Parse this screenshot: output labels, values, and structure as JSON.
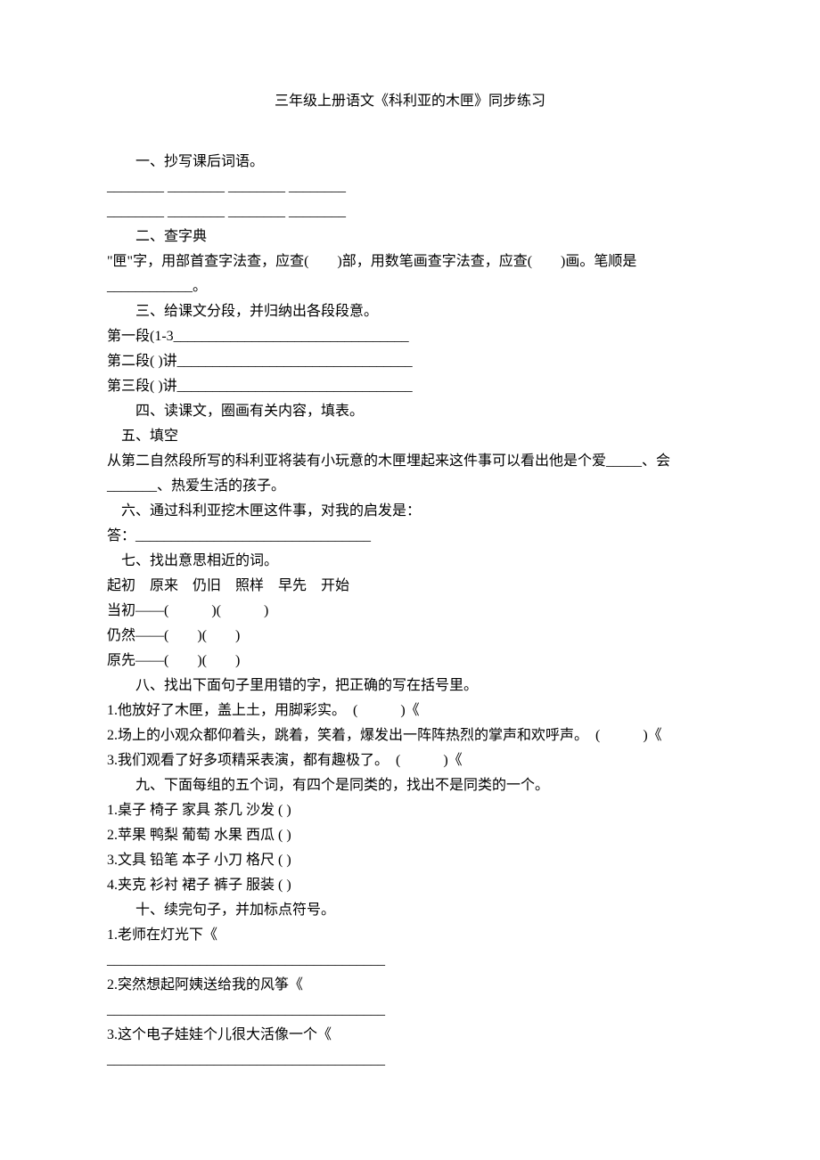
{
  "title": "三年级上册语文《科利亚的木匣》同步练习",
  "sections": {
    "s1": {
      "heading": "一、抄写课后词语。",
      "blank1": "________ ________ ________ ________",
      "blank2": "________ ________ ________ ________"
    },
    "s2": {
      "heading": "二、查字典",
      "line1": "\"匣\"字，用部首查字法查，应查(　　)部，用数笔画查字法查，应查(　　)画。笔顺是____________。"
    },
    "s3": {
      "heading": "三、给课文分段，并归纳出各段段意。",
      "l1": "第一段(1-3_________________________________",
      "l2": "第二段( )讲_________________________________",
      "l3": "第三段( )讲_________________________________"
    },
    "s4": {
      "heading": "四、读课文，圈画有关内容，填表。"
    },
    "s5": {
      "heading": "五、填空",
      "l1": "从第二自然段所写的科利亚将装有小玩意的木匣埋起来这件事可以看出他是个爱_____、会_______、热爱生活的孩子。"
    },
    "s6": {
      "heading": "六、通过科利亚挖木匣这件事，对我的启发是：",
      "l1": "答：_________________________________"
    },
    "s7": {
      "heading": "七、找出意思相近的词。",
      "l1": "起初　原来　仍旧　照样　早先　开始",
      "l2": "当初——(　　　)(　　　)",
      "l3": "仍然——(　　)(　　)",
      "l4": "原先——(　　)(　　)"
    },
    "s8": {
      "heading": "八、找出下面句子里用错的字，把正确的写在括号里。",
      "l1": "1.他放好了木匣，盖上土，用脚彩实。　(　　　)《",
      "l2": "2.场上的小观众都仰着头，跳着，笑着，爆发出一阵阵热烈的掌声和欢呼声。　(　　　)《",
      "l3": "3.我们观看了好多项精采表演，都有趣极了。　(　　　)《"
    },
    "s9": {
      "heading": "九、下面每组的五个词，有四个是同类的，找出不是同类的一个。",
      "l1": "1.桌子 椅子 家具 茶几 沙发 ( )",
      "l2": "2.苹果 鸭梨 葡萄 水果 西瓜 ( )",
      "l3": "3.文具 铅笔 本子 小刀 格尺 ( )",
      "l4": "4.夹克 衫衬 裙子 裤子 服装 ( )"
    },
    "s10": {
      "heading": "十、续完句子，并加标点符号。",
      "l1": "1.老师在灯光下《",
      "b1": "_______________________________________",
      "l2": "2.突然想起阿姨送给我的风筝《",
      "b2": "_______________________________________",
      "l3": "3.这个电子娃娃个儿很大活像一个《",
      "b3": "_______________________________________"
    }
  }
}
